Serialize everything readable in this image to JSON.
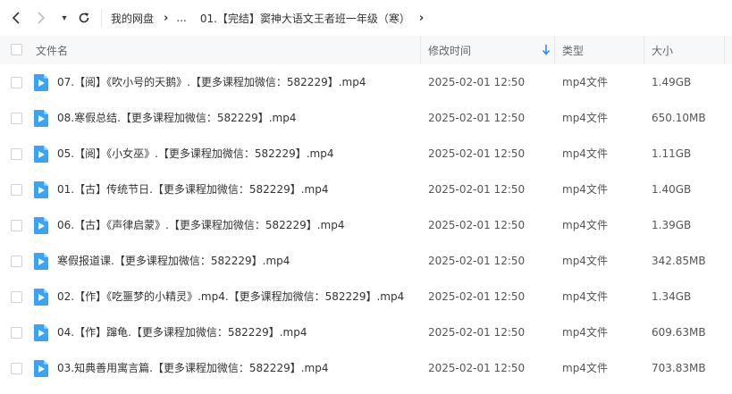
{
  "nav": {
    "back_icon": "chevron-left-icon",
    "forward_icon": "chevron-right-icon",
    "history_glyph": "▾",
    "refresh_icon": "refresh-icon"
  },
  "breadcrumb": {
    "root": "我的网盘",
    "ellipsis": "...",
    "current": "01.【完结】窦神大语文王者班一年级（寒）"
  },
  "header": {
    "name": "文件名",
    "time": "修改时间",
    "type": "类型",
    "size": "大小",
    "sort_color": "#2f80ed"
  },
  "file_icon_color": "#3aa3f5",
  "files": [
    {
      "name": "07.【阅】《吹小号的天鹅》.【更多课程加微信：582229】.mp4",
      "time": "2025-02-01 12:50",
      "type": "mp4文件",
      "size": "1.49GB"
    },
    {
      "name": "08.寒假总结.【更多课程加微信：582229】.mp4",
      "time": "2025-02-01 12:50",
      "type": "mp4文件",
      "size": "650.10MB"
    },
    {
      "name": "05.【阅】《小女巫》.【更多课程加微信：582229】.mp4",
      "time": "2025-02-01 12:50",
      "type": "mp4文件",
      "size": "1.11GB"
    },
    {
      "name": "01.【古】传统节日.【更多课程加微信：582229】.mp4",
      "time": "2025-02-01 12:50",
      "type": "mp4文件",
      "size": "1.40GB"
    },
    {
      "name": "06.【古】《声律启蒙》.【更多课程加微信：582229】.mp4",
      "time": "2025-02-01 12:50",
      "type": "mp4文件",
      "size": "1.39GB"
    },
    {
      "name": "寒假报道课.【更多课程加微信：582229】.mp4",
      "time": "2025-02-01 12:50",
      "type": "mp4文件",
      "size": "342.85MB"
    },
    {
      "name": "02.【作】《吃噩梦的小精灵》.mp4.【更多课程加微信：582229】.mp4",
      "time": "2025-02-01 12:50",
      "type": "mp4文件",
      "size": "1.34GB"
    },
    {
      "name": "04.【作】蹿龟.【更多课程加微信：582229】.mp4",
      "time": "2025-02-01 12:50",
      "type": "mp4文件",
      "size": "609.63MB"
    },
    {
      "name": "03.知典善用寓言篇.【更多课程加微信：582229】.mp4",
      "time": "2025-02-01 12:50",
      "type": "mp4文件",
      "size": "703.83MB"
    }
  ]
}
